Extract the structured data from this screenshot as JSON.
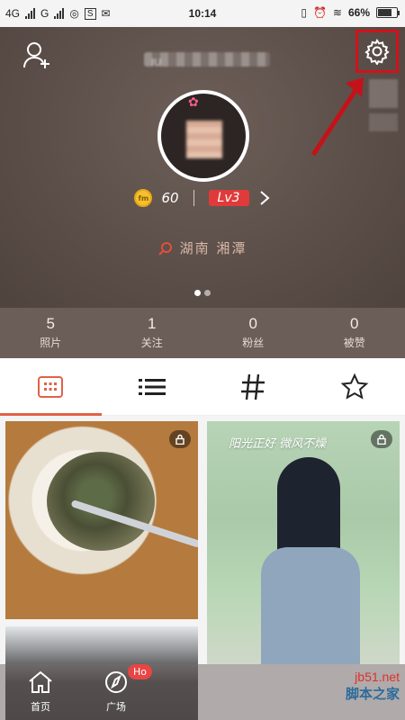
{
  "status_bar": {
    "network1": "4G",
    "network2": "G",
    "time": "10:14",
    "battery": "66%",
    "battery_level": 0.66
  },
  "header": {
    "username": "IU"
  },
  "profile": {
    "coins": "60",
    "level": "Lv3",
    "location": "湖南 湘潭",
    "carousel": {
      "pages": 2,
      "active": 0
    }
  },
  "counts": [
    {
      "value": "5",
      "label": "照片"
    },
    {
      "value": "1",
      "label": "关注"
    },
    {
      "value": "0",
      "label": "粉丝"
    },
    {
      "value": "0",
      "label": "被赞"
    }
  ],
  "tabs": [
    {
      "name": "grid",
      "icon": "grid-icon",
      "active": true
    },
    {
      "name": "list",
      "icon": "list-icon",
      "active": false
    },
    {
      "name": "topics",
      "icon": "hash-icon",
      "active": false
    },
    {
      "name": "favorites",
      "icon": "star-icon",
      "active": false
    }
  ],
  "photos": {
    "caption": "阳光正好 微风不燥"
  },
  "bottom_nav": {
    "home_label": "首页",
    "plaza_label": "广场",
    "hot_badge": "Ho"
  },
  "watermark": {
    "site": "jb51.net",
    "brand": "脚本之家"
  },
  "colors": {
    "header_bg": "#5c4f49",
    "accent": "#e06248",
    "highlight_box": "#d1121b",
    "level_badge": "#e03a3a"
  }
}
